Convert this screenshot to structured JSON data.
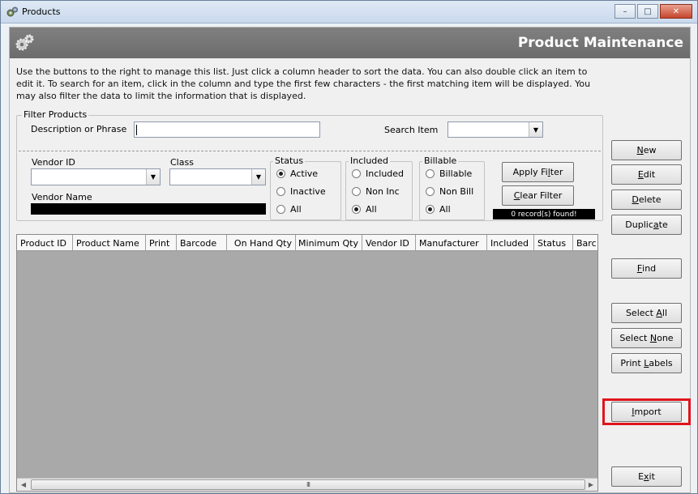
{
  "window": {
    "title": "Products",
    "controls": {
      "minimize": "–",
      "maximize": "□",
      "close": "✕"
    }
  },
  "banner": {
    "title": "Product Maintenance"
  },
  "instructions": "Use the buttons to the right to manage this list.  Just click a column header to sort the data.  You can also double click an item to edit it.  To search for an item, click in the column and type the first few characters - the first matching item will be displayed.  You may also filter the data to limit the information that is displayed.",
  "filter": {
    "group_label": "Filter Products",
    "description_label": "Description or Phrase",
    "description_value": "",
    "search_item_label": "Search Item",
    "search_item_value": "",
    "vendor_id_label": "Vendor ID",
    "vendor_id_value": "",
    "class_label": "Class",
    "class_value": "",
    "vendor_name_label": "Vendor Name",
    "status": {
      "label": "Status",
      "options": [
        "Active",
        "Inactive",
        "All"
      ],
      "selected": "Active"
    },
    "included": {
      "label": "Included",
      "options": [
        "Included",
        "Non Inc",
        "All"
      ],
      "selected": "All"
    },
    "billable": {
      "label": "Billable",
      "options": [
        "Billable",
        "Non Bill",
        "All"
      ],
      "selected": "All"
    },
    "apply_button": {
      "before": "Apply Fi",
      "key": "l",
      "after": "ter"
    },
    "clear_button": {
      "before": "",
      "key": "C",
      "after": "lear Filter"
    },
    "records_found": "0 record(s) found!"
  },
  "grid": {
    "columns": [
      "Product ID",
      "Product Name",
      "Print",
      "Barcode",
      "On Hand Qty",
      "Minimum Qty",
      "Vendor ID",
      "Manufacturer",
      "Included",
      "Status",
      "Barc"
    ],
    "rows": [],
    "scroll_grip": "III"
  },
  "buttons": {
    "new": {
      "before": "",
      "key": "N",
      "after": "ew"
    },
    "edit": {
      "before": "",
      "key": "E",
      "after": "dit"
    },
    "delete": {
      "before": "",
      "key": "D",
      "after": "elete"
    },
    "duplicate": {
      "before": "Duplic",
      "key": "a",
      "after": "te"
    },
    "find": {
      "before": "",
      "key": "F",
      "after": "ind"
    },
    "select_all": {
      "before": "Select ",
      "key": "A",
      "after": "ll"
    },
    "select_none": {
      "before": "Select ",
      "key": "N",
      "after": "one"
    },
    "print_labels": {
      "before": "Print ",
      "key": "L",
      "after": "abels"
    },
    "import": {
      "before": "",
      "key": "I",
      "after": "mport"
    },
    "exit": {
      "before": "E",
      "key": "x",
      "after": "it"
    }
  },
  "highlight_color": "#e0141c"
}
